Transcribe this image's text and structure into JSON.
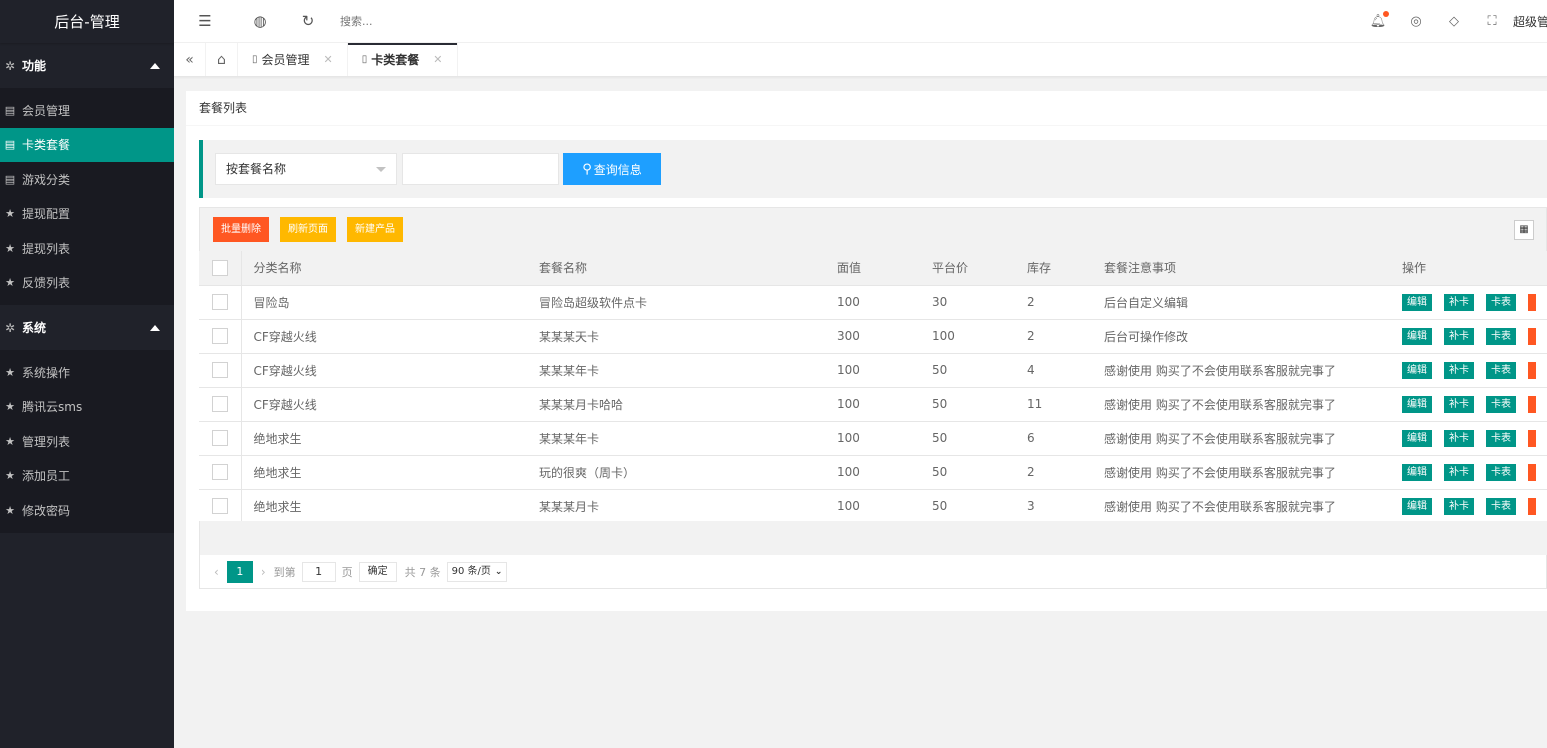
{
  "sidebar": {
    "title": "后台-管理",
    "groups": [
      {
        "label": "功能",
        "items": [
          {
            "label": "会员管理",
            "icon": "doc-icon",
            "active": false
          },
          {
            "label": "卡类套餐",
            "icon": "doc-icon",
            "active": true
          },
          {
            "label": "游戏分类",
            "icon": "doc-icon",
            "active": false
          },
          {
            "label": "提现配置",
            "icon": "star-icon",
            "active": false
          },
          {
            "label": "提现列表",
            "icon": "star-icon",
            "active": false
          },
          {
            "label": "反馈列表",
            "icon": "star-icon",
            "active": false
          }
        ]
      },
      {
        "label": "系统",
        "items": [
          {
            "label": "系统操作",
            "icon": "star-icon",
            "active": false
          },
          {
            "label": "腾讯云sms",
            "icon": "star-icon",
            "active": false
          },
          {
            "label": "管理列表",
            "icon": "star-icon",
            "active": false
          },
          {
            "label": "添加员工",
            "icon": "star-icon",
            "active": false
          },
          {
            "label": "修改密码",
            "icon": "star-icon",
            "active": false
          }
        ]
      }
    ]
  },
  "header": {
    "search_placeholder": "搜索...",
    "user": "超级管"
  },
  "tabs": [
    {
      "label": "会员管理",
      "active": false
    },
    {
      "label": "卡类套餐",
      "active": true
    }
  ],
  "card": {
    "title": "套餐列表",
    "search": {
      "select_value": "按套餐名称",
      "button_label": "查询信息"
    },
    "toolbar": {
      "batch_delete": "批量删除",
      "refresh": "刷新页面",
      "new_product": "新建产品"
    },
    "columns": [
      "分类名称",
      "套餐名称",
      "面值",
      "平台价",
      "库存",
      "套餐注意事项",
      "操作"
    ],
    "rows": [
      {
        "category": "冒险岛",
        "name": "冒险岛超级软件点卡",
        "face": "100",
        "price": "30",
        "stock": "2",
        "note": "后台自定义编辑"
      },
      {
        "category": "CF穿越火线",
        "name": "某某某天卡",
        "face": "300",
        "price": "100",
        "stock": "2",
        "note": "后台可操作修改"
      },
      {
        "category": "CF穿越火线",
        "name": "某某某年卡",
        "face": "100",
        "price": "50",
        "stock": "4",
        "note": "感谢使用 购买了不会使用联系客服就完事了"
      },
      {
        "category": "CF穿越火线",
        "name": "某某某月卡哈哈",
        "face": "100",
        "price": "50",
        "stock": "11",
        "note": "感谢使用 购买了不会使用联系客服就完事了"
      },
      {
        "category": "绝地求生",
        "name": "某某某年卡",
        "face": "100",
        "price": "50",
        "stock": "6",
        "note": "感谢使用 购买了不会使用联系客服就完事了"
      },
      {
        "category": "绝地求生",
        "name": "玩的很爽（周卡）",
        "face": "100",
        "price": "50",
        "stock": "2",
        "note": "感谢使用 购买了不会使用联系客服就完事了"
      },
      {
        "category": "绝地求生",
        "name": "某某某月卡",
        "face": "100",
        "price": "50",
        "stock": "3",
        "note": "感谢使用 购买了不会使用联系客服就完事了"
      }
    ],
    "ops": {
      "edit": "编辑",
      "refill": "补卡",
      "cardlist": "卡表"
    },
    "pager": {
      "current": "1",
      "goto_prefix": "到第",
      "goto_value": "1",
      "goto_suffix": "页",
      "confirm": "确定",
      "total": "共 7 条",
      "page_size": "90 条/页"
    }
  },
  "colors": {
    "accent": "#009688",
    "sidebar_bg": "#20222a",
    "danger": "#ff5722",
    "warn": "#ffb800",
    "primary": "#1e9fff"
  }
}
